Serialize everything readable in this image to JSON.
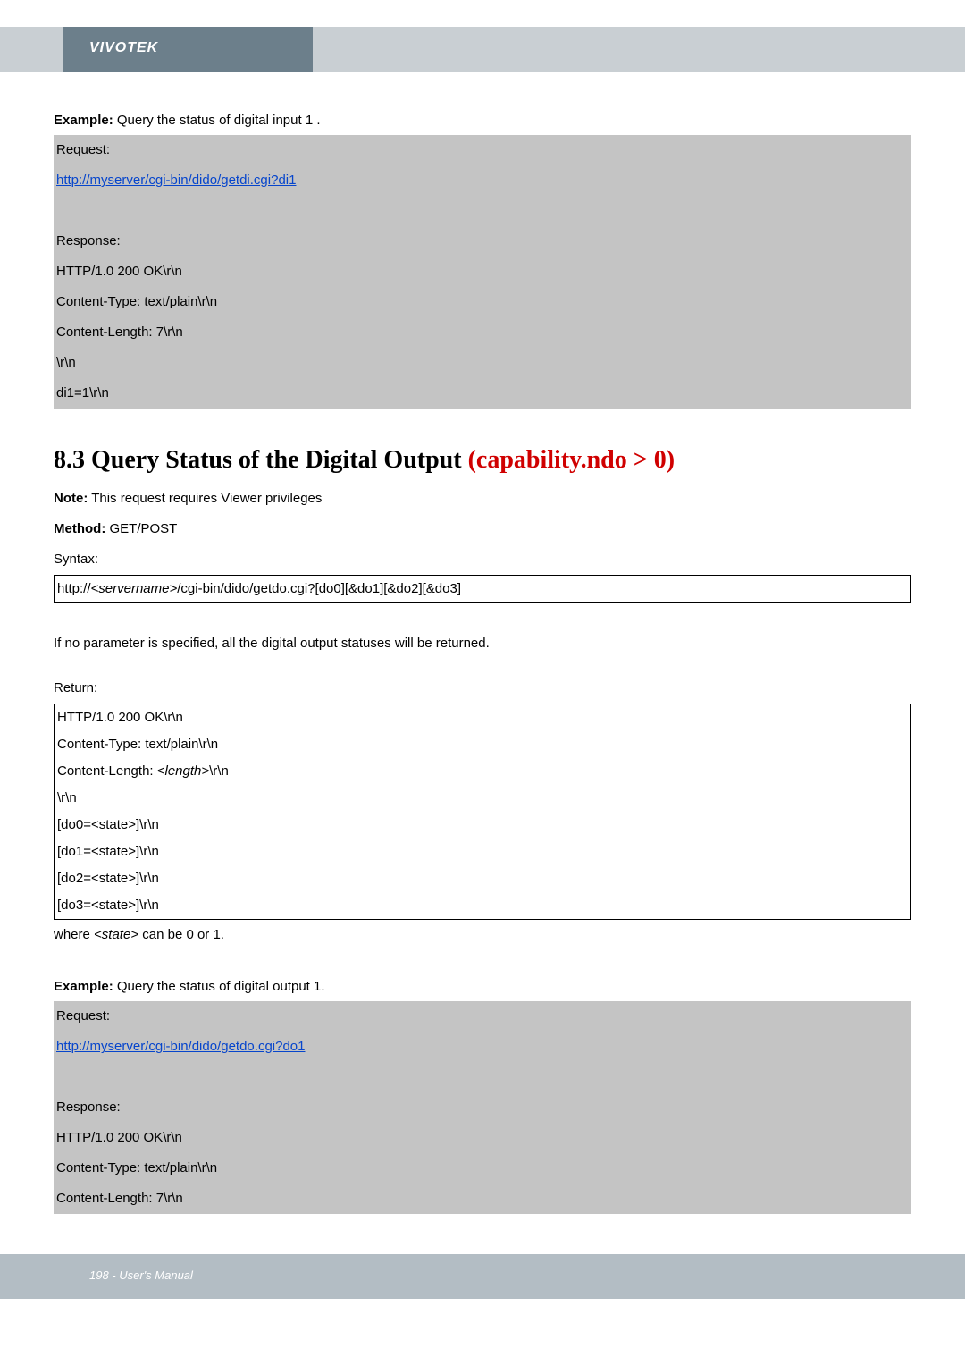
{
  "brand": "VIVOTEK",
  "example1": {
    "label": "Example:",
    "text": " Query the status of digital input 1 .",
    "request_label": "Request:",
    "request_url": "http://myserver/cgi-bin/dido/getdi.cgi?di1",
    "response_label": "Response:",
    "resp_lines": [
      "HTTP/1.0 200 OK\\r\\n",
      "Content-Type: text/plain\\r\\n",
      "Content-Length: 7\\r\\n",
      "\\r\\n",
      "di1=1\\r\\n"
    ]
  },
  "section": {
    "number": "8.3 Query Status of the Digital Output ",
    "highlight": "(capability.ndo > 0)",
    "note_label": "Note:",
    "note_text": " This request requires Viewer privileges",
    "method_label": "Method:",
    "method_text": " GET/POST",
    "syntax_label": "Syntax:",
    "syntax_prefix": "http://",
    "syntax_server": "<servername>",
    "syntax_suffix": "/cgi-bin/dido/getdo.cgi?[do0][&do1][&do2][&do3]",
    "para": "If no parameter is specified, all the digital output statuses will be returned.",
    "return_label": "Return:",
    "return_block": {
      "l1": "HTTP/1.0 200 OK\\r\\n",
      "l2": "Content-Type: text/plain\\r\\n",
      "l3a": "Content-Length: ",
      "l3b": "<length>",
      "l3c": "\\r\\n",
      "l4": "\\r\\n",
      "l5": "[do0=<state>]\\r\\n",
      "l6": "[do1=<state>]\\r\\n",
      "l7": "[do2=<state>]\\r\\n",
      "l8": "[do3=<state>]\\r\\n"
    },
    "where_a": "where ",
    "where_b": "<state>",
    "where_c": " can be 0 or 1."
  },
  "example2": {
    "label": "Example:",
    "text": " Query the status of digital output 1.",
    "request_label": "Request:",
    "request_url": "http://myserver/cgi-bin/dido/getdo.cgi?do1",
    "response_label": "Response:",
    "resp_lines": [
      "HTTP/1.0 200 OK\\r\\n",
      "Content-Type: text/plain\\r\\n",
      "Content-Length: 7\\r\\n"
    ]
  },
  "footer": "198 - User's Manual"
}
